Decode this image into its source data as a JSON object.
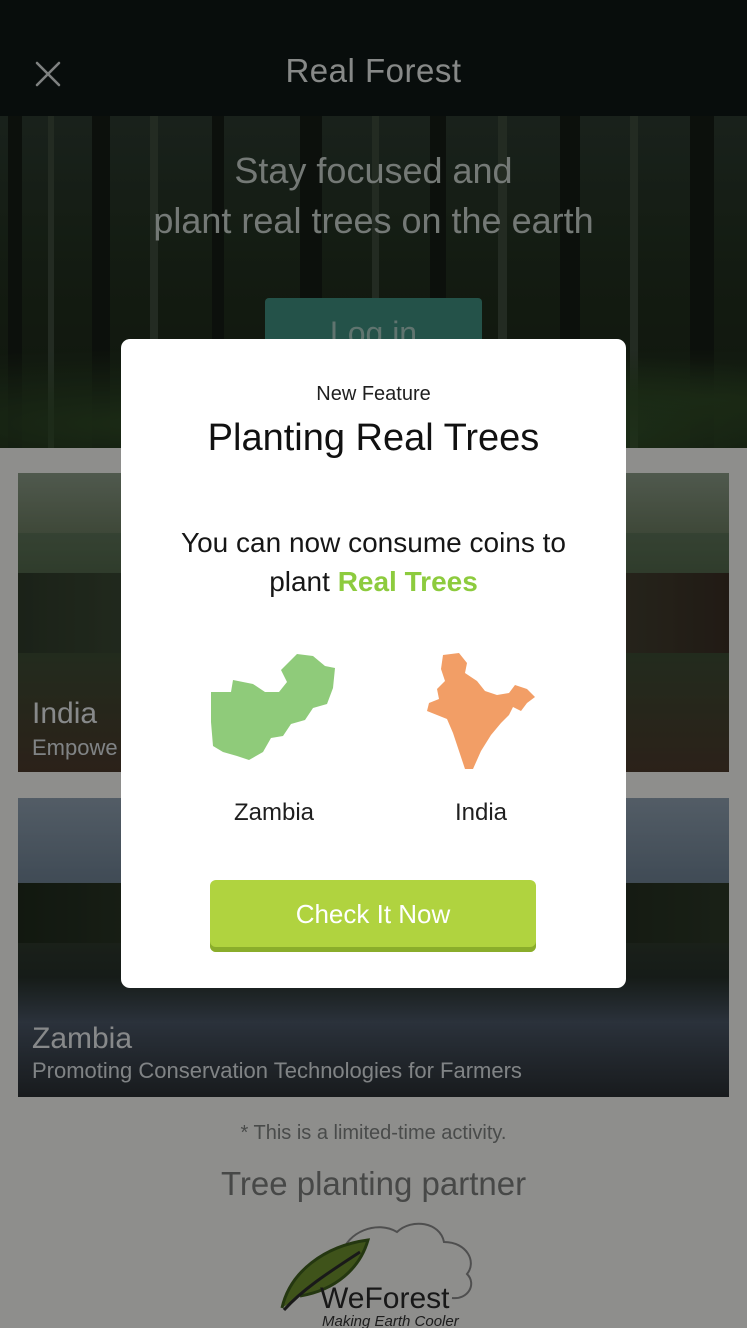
{
  "header": {
    "title": "Real Forest",
    "close_icon": "close-icon"
  },
  "hero": {
    "line1": "Stay focused and",
    "line2": "plant real trees on the earth",
    "login_label": "Log in"
  },
  "projects": [
    {
      "title": "India",
      "subtitle": "Empowe"
    },
    {
      "title": "Zambia",
      "subtitle": "Promoting Conservation Technologies for Farmers"
    }
  ],
  "footer": {
    "note": "* This is a limited-time activity.",
    "partner_heading": "Tree planting partner",
    "logo_name": "WeForest",
    "logo_tagline": "Making Earth Cooler"
  },
  "modal": {
    "eyebrow": "New Feature",
    "title": "Planting Real Trees",
    "body_line1": "You can now consume coins to",
    "body_line2_prefix": "plant ",
    "body_highlight": "Real Trees",
    "countries": [
      {
        "name": "Zambia",
        "icon": "zambia-map-icon",
        "color": "#8fcb7a"
      },
      {
        "name": "India",
        "icon": "india-map-icon",
        "color": "#f29e66"
      }
    ],
    "cta_label": "Check It Now"
  },
  "colors": {
    "accent_green": "#8dcb3e",
    "cta_green": "#b0d33f",
    "login_teal": "#3f8e7e",
    "header_bg": "#0f1715"
  }
}
